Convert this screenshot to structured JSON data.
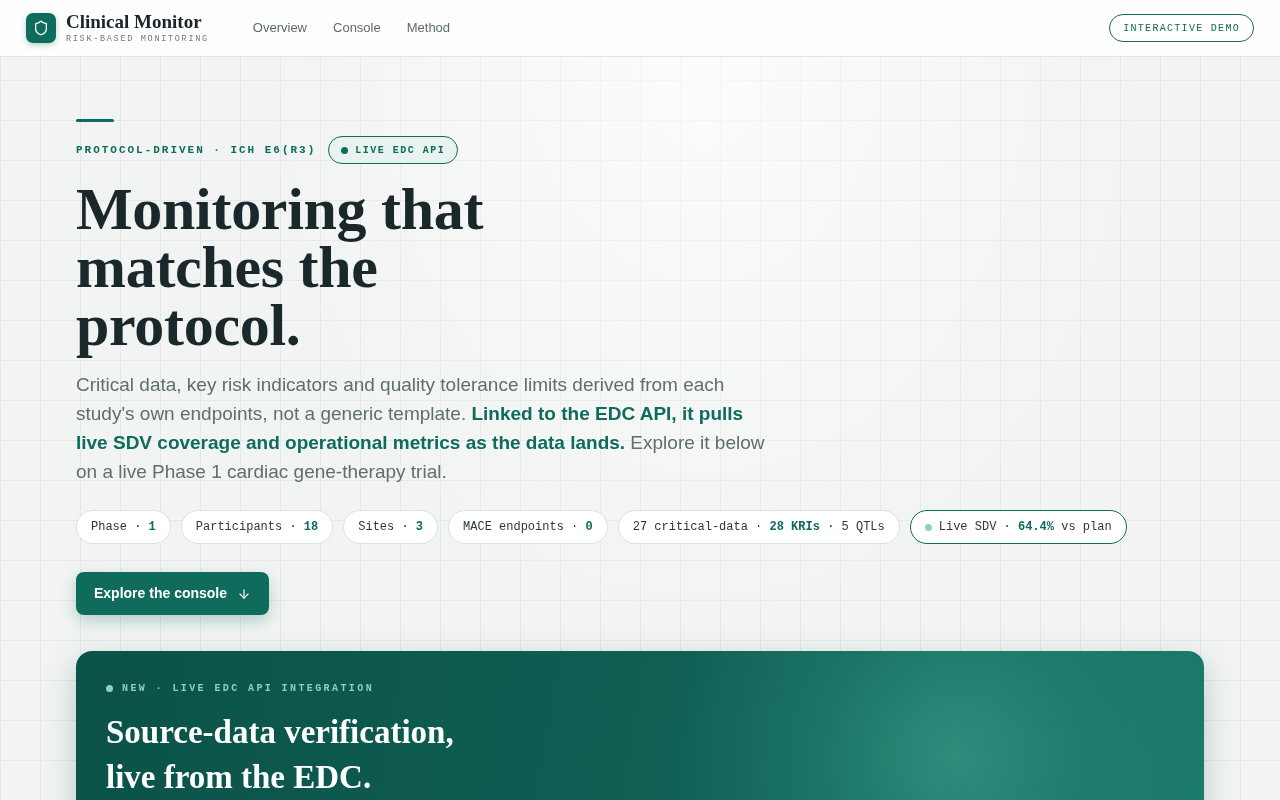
{
  "header": {
    "brand": {
      "title": "Clinical Monitor",
      "subtitle": "RISK-BASED MONITORING"
    },
    "nav": [
      "Overview",
      "Console",
      "Method"
    ],
    "cta": "INTERACTIVE DEMO"
  },
  "hero": {
    "eyebrow": "PROTOCOL-DRIVEN · ICH E6(R3)",
    "badge": {
      "label": "LIVE EDC API",
      "live": true
    },
    "title": "Monitoring that matches the protocol.",
    "lead": "Critical data, key risk indicators and quality tolerance limits derived from each study's own endpoints, not a generic template. **Linked to the EDC API, it pulls live SDV coverage and operational metrics as the data lands.** Explore it below on a live Phase 1 cardiac gene-therapy trial.",
    "chips": [
      {
        "text": "Phase · **1**",
        "live": false
      },
      {
        "text": "Participants · **18**",
        "live": false
      },
      {
        "text": "Sites · **3**",
        "live": false
      },
      {
        "text": "MACE endpoints · **0**",
        "live": false
      },
      {
        "text": "27 critical-data · **28 KRIs** · 5 QTLs",
        "live": false
      },
      {
        "text": "Live SDV · **64.4%** vs plan",
        "live": true
      }
    ],
    "button": "Explore the console"
  },
  "feature": {
    "eyebrow": "NEW · LIVE EDC API INTEGRATION",
    "title": "Source-data verification, live from the EDC."
  }
}
